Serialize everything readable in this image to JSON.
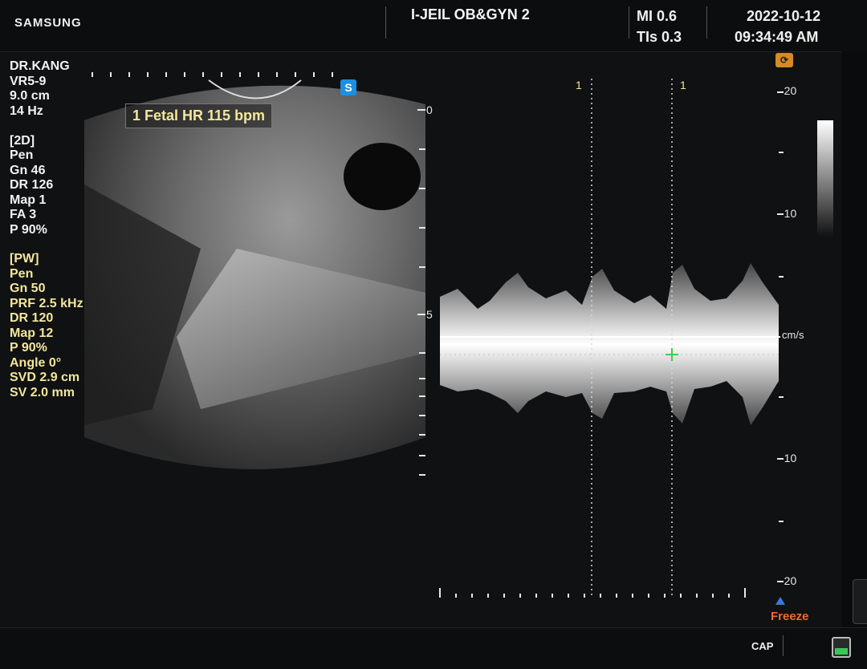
{
  "header": {
    "brand": "SAMSUNG",
    "hospital": "I-JEIL OB&GYN 2",
    "mi": "MI   0.6",
    "tis": "TIs   0.3",
    "date": "2022-10-12",
    "time": "09:34:49 AM"
  },
  "params_2d": [
    "DR.KANG",
    "VR5-9",
    "9.0 cm",
    "14 Hz",
    "",
    "[2D]",
    "Pen",
    "Gn  46",
    "DR  126",
    "Map 1",
    "FA  3",
    "P    90%"
  ],
  "params_pw": [
    "[PW]",
    "Pen",
    "Gn  50",
    "PRF 2.5 kHz",
    "DR  120",
    "Map 12",
    "P    90%",
    "Angle 0°",
    "SVD 2.9 cm",
    "SV  2.0 mm"
  ],
  "measurement": {
    "label": "1  Fetal HR  115 bpm",
    "cursor_labels": [
      "1",
      "1"
    ]
  },
  "depth_scale": [
    "0",
    "5"
  ],
  "velocity_scale": {
    "labels": [
      "-20",
      "-10",
      "-10",
      "-20"
    ],
    "unit": "cm/s"
  },
  "status": {
    "freeze": "Freeze",
    "cap": "CAP"
  },
  "icons": {
    "s_marker": "S",
    "camera": "camera-icon",
    "storage": "storage-icon"
  },
  "colors": {
    "yellow_text": "#f3e79b",
    "freeze": "#f06a2a",
    "accent_blue": "#1e8fe0"
  }
}
